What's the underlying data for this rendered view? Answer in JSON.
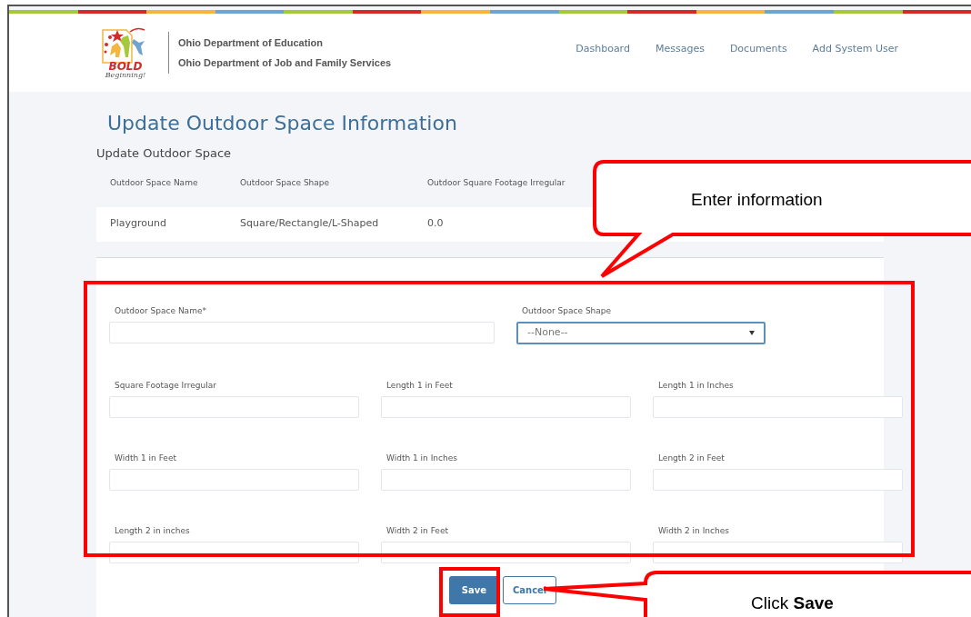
{
  "header": {
    "logo": {
      "word": "BOLD",
      "tagline": "Beginning!"
    },
    "organizations": [
      "Ohio Department of Education",
      "Ohio Department of Job and Family Services"
    ],
    "nav": [
      "Dashboard",
      "Messages",
      "Documents",
      "Add System User"
    ]
  },
  "page_title": "Update Outdoor Space Information",
  "section_title": "Update Outdoor Space",
  "table": {
    "columns": [
      "Outdoor Space Name",
      "Outdoor Space Shape",
      "Outdoor Square Footage Irregular"
    ],
    "rows": [
      [
        "Playground",
        "Square/Rectangle/L-Shaped",
        "0.0"
      ]
    ]
  },
  "form": {
    "rows": [
      [
        {
          "kind": "text",
          "label": "Outdoor Space Name*"
        },
        {
          "kind": "select",
          "label": "Outdoor Space Shape",
          "value": "--None--"
        }
      ],
      [
        {
          "kind": "text",
          "label": "Square Footage Irregular"
        },
        {
          "kind": "text",
          "label": "Length 1 in Feet"
        },
        {
          "kind": "text",
          "label": "Length 1 in Inches"
        }
      ],
      [
        {
          "kind": "text",
          "label": "Width 1 in Feet"
        },
        {
          "kind": "text",
          "label": "Width 1 in Inches"
        },
        {
          "kind": "text",
          "label": "Length 2 in Feet"
        }
      ],
      [
        {
          "kind": "text",
          "label": "Length 2 in inches"
        },
        {
          "kind": "text",
          "label": "Width 2 in Feet"
        },
        {
          "kind": "text",
          "label": "Width 2 in Inches"
        }
      ]
    ]
  },
  "buttons": [
    {
      "label": "Save",
      "kind": "primary"
    },
    {
      "label": "Cancel",
      "kind": "secondary"
    }
  ],
  "annotations": [
    {
      "kind": "top",
      "text": "Enter information"
    },
    {
      "kind": "side",
      "text": "Click **Save**"
    }
  ]
}
